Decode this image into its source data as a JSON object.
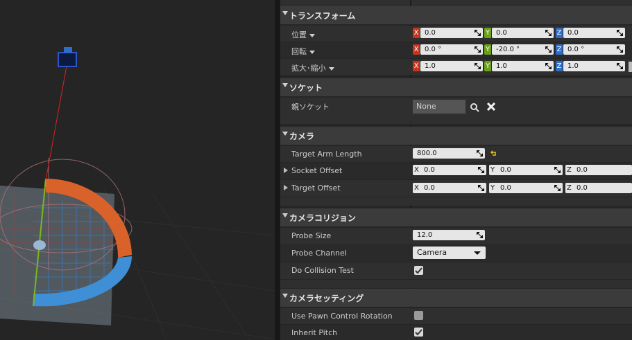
{
  "colors": {
    "x_axis": "#c6361f",
    "y_axis": "#6aa01a",
    "z_axis": "#2e6dc8",
    "category_bg": "#3b3b3b",
    "row_bg": "#2f2f2f"
  },
  "transform": {
    "title": "トランスフォーム",
    "location": {
      "label": "位置",
      "x": "0.0",
      "y": "0.0",
      "z": "0.0"
    },
    "rotation": {
      "label": "回転",
      "x": "0.0 °",
      "y": "-20.0 °",
      "z": "0.0 °"
    },
    "scale": {
      "label": "拡大･縮小",
      "x": "1.0",
      "y": "1.0",
      "z": "1.0"
    }
  },
  "socket": {
    "title": "ソケット",
    "parent_label": "親ソケット",
    "parent_value": "None",
    "search_icon": "search-icon",
    "clear_icon": "close-icon"
  },
  "camera": {
    "title": "カメラ",
    "arm_length": {
      "label": "Target Arm Length",
      "value": "800.0",
      "reset_icon": "reset-arrow-icon"
    },
    "socket_offset": {
      "label": "Socket Offset",
      "x": "0.0",
      "y": "0.0",
      "z": "0.0"
    },
    "target_offset": {
      "label": "Target Offset",
      "x": "0.0",
      "y": "0.0",
      "z": "0.0"
    }
  },
  "collision": {
    "title": "カメラコリジョン",
    "probe_size": {
      "label": "Probe Size",
      "value": "12.0"
    },
    "probe_channel": {
      "label": "Probe Channel",
      "value": "Camera"
    },
    "do_collision_test": {
      "label": "Do Collision Test",
      "checked": true
    }
  },
  "settings": {
    "title": "カメラセッティング",
    "use_pawn_control_rotation": {
      "label": "Use Pawn Control Rotation",
      "checked": false
    },
    "inherit_pitch": {
      "label": "Inherit Pitch",
      "checked": true
    }
  },
  "axis_labels": {
    "x": "X",
    "y": "Y",
    "z": "Z"
  }
}
